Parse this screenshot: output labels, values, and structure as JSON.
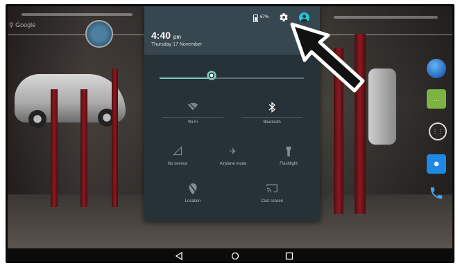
{
  "wallpaper": {
    "search_hint": "Google"
  },
  "status": {
    "battery_percent": "67%"
  },
  "header": {
    "time": "4:40",
    "ampm": "pm",
    "date": "Thursday 17 November"
  },
  "brightness": {
    "level_fraction": 0.36
  },
  "tiles": [
    {
      "id": "wifi",
      "label": "Wi-Fi",
      "icon": "wifi-icon",
      "on": false
    },
    {
      "id": "bluetooth",
      "label": "Bluetooth",
      "icon": "bluetooth-icon",
      "on": true
    },
    {
      "id": "no-service",
      "label": "No service",
      "icon": "signal-icon",
      "on": false
    },
    {
      "id": "airplane",
      "label": "Airplane mode",
      "icon": "airplane-icon",
      "on": false
    },
    {
      "id": "flashlight",
      "label": "Flashlight",
      "icon": "flashlight-icon",
      "on": false
    },
    {
      "id": "location",
      "label": "Location",
      "icon": "location-off-icon",
      "on": false
    },
    {
      "id": "cast",
      "label": "Cast screen",
      "icon": "cast-icon",
      "on": false
    }
  ],
  "colors": {
    "shade": "#263238",
    "shade_header": "#37474f",
    "accent": "#80cbc4",
    "avatar": "#26c6da"
  }
}
